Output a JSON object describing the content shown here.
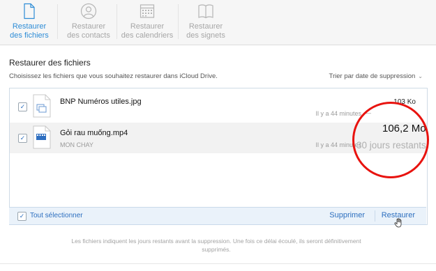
{
  "tabs": [
    {
      "line1": "Restaurer",
      "line2": "des fichiers",
      "icon": "document-icon",
      "active": true
    },
    {
      "line1": "Restaurer",
      "line2": "des contacts",
      "icon": "contact-icon",
      "active": false
    },
    {
      "line1": "Restaurer",
      "line2": "des calendriers",
      "icon": "calendar-icon",
      "active": false
    },
    {
      "line1": "Restaurer",
      "line2": "des signets",
      "icon": "bookmark-icon",
      "active": false
    }
  ],
  "main": {
    "title": "Restaurer des fichiers",
    "subtitle": "Choisissez les fichiers que vous souhaitez restaurer dans iCloud Drive.",
    "sort_label": "Trier par date de suppression"
  },
  "files": [
    {
      "name": "BNP Numéros utiles.jpg",
      "folder": "",
      "size": "103 Ko",
      "deleted": "Il y a 44 minutes",
      "checked": true,
      "icon": "image-file-icon"
    },
    {
      "name": "Gỏi rau muống.mp4",
      "folder": "MON CHAY",
      "size": "106,2 Mo",
      "deleted": "Il y a 44 minutes",
      "remaining": "30 jours restants",
      "checked": true,
      "icon": "video-file-icon"
    }
  ],
  "footer": {
    "select_all": "Tout sélectionner",
    "delete": "Supprimer",
    "restore": "Restaurer"
  },
  "note": "Les fichiers indiquent les jours restants avant la suppression. Une fois ce délai écoulé, ils seront définitivement supprimés.",
  "colors": {
    "accent": "#2d8cd6",
    "link": "#2d6fbf",
    "annotation": "#e8130f"
  }
}
